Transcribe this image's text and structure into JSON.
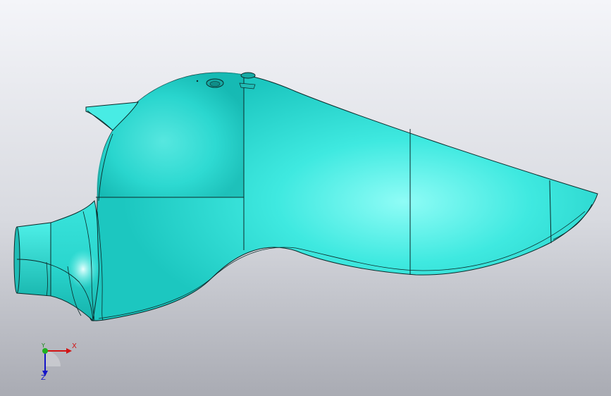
{
  "viewport": {
    "background_top": "#f4f5f9",
    "background_bottom": "#a9abb3"
  },
  "model": {
    "surface_color": "#2ee0d8",
    "highlight_color": "#b8fffb",
    "edge_color": "#0c2a2a"
  },
  "triad": {
    "x_label": "X",
    "y_label": "Y",
    "z_label": "Z",
    "x_color": "#d21414",
    "y_color": "#1a8a1a",
    "z_color": "#1414c8"
  }
}
